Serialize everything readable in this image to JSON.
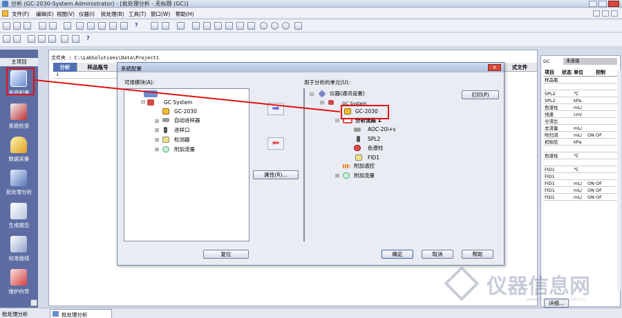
{
  "window": {
    "title": "分析 (GC-2030-System Administrator) - [批处理分析 - 无标题 (GC)]"
  },
  "menu": [
    "文件(F)",
    "编辑(E)",
    "视图(V)",
    "仪器(I)",
    "批处理(B)",
    "工具(T)",
    "窗口(W)",
    "帮助(H)"
  ],
  "left_panel": {
    "header": "主项目",
    "items": [
      "系统配置",
      "系统检查",
      "数据采集",
      "批处理分析",
      "生成报告",
      "校准曲线",
      "维护向导"
    ],
    "bottom_label": "批处理分析"
  },
  "main": {
    "file_path": "文件夹 : C:\\LabSolutions\\Data\\Project1",
    "columns": [
      "分析",
      "样品瓶号",
      "式文件"
    ],
    "row1": "1"
  },
  "right_panel": {
    "gc_label": "GC",
    "status": "未连接",
    "columns": [
      "项目",
      "状态",
      "单位",
      "控制"
    ],
    "rows": [
      {
        "name": "样品瓶",
        "unit": "",
        "ctrl": ""
      },
      {
        "name": "",
        "unit": "",
        "ctrl": ""
      },
      {
        "name": "SPL2",
        "unit": "℃",
        "ctrl": ""
      },
      {
        "name": "SPL2",
        "unit": "kPa",
        "ctrl": ""
      },
      {
        "name": "色谱柱",
        "unit": "mL/",
        "ctrl": ""
      },
      {
        "name": "线速",
        "unit": "cm/",
        "ctrl": ""
      },
      {
        "name": "分流比",
        "unit": "",
        "ctrl": ""
      },
      {
        "name": "总流量",
        "unit": "mL/",
        "ctrl": ""
      },
      {
        "name": "吹扫流",
        "unit": "mL/",
        "ctrl": "ON  OF"
      },
      {
        "name": "初始压",
        "unit": "kPa",
        "ctrl": ""
      },
      {
        "name": "",
        "unit": "",
        "ctrl": ""
      },
      {
        "name": "色谱柱",
        "unit": "℃",
        "ctrl": ""
      },
      {
        "name": "",
        "unit": "",
        "ctrl": ""
      },
      {
        "name": "FID1",
        "unit": "℃",
        "ctrl": ""
      },
      {
        "name": "FID1",
        "unit": "",
        "ctrl": ""
      },
      {
        "name": "FID1",
        "unit": "mL/",
        "ctrl": "ON  OF"
      },
      {
        "name": "FID1",
        "unit": "mL/",
        "ctrl": "ON  OF"
      },
      {
        "name": "FID1",
        "unit": "mL/",
        "ctrl": "ON  OF"
      }
    ],
    "detail_button": "详细..."
  },
  "dialog": {
    "title": "系统配置",
    "available_label": "可用模块(A):",
    "units_label": "用于分析的单元(U):",
    "left_tree": [
      "GC System",
      "GC-2030",
      "自动进样器",
      "进样口",
      "检测器",
      "附加流量"
    ],
    "right_tree": [
      "仪器(通讯设置)",
      "GC System",
      "GC-2030",
      "分析流路 1",
      "AOC-20i+s",
      "SPL2",
      "色谱柱",
      "FID1",
      "附加温控",
      "附加流量"
    ],
    "buttons": {
      "print": "打印(P)",
      "properties": "属性(R)...",
      "reset": "复位",
      "ok": "确定",
      "cancel": "取消",
      "help": "帮助"
    }
  },
  "bottom_tab": "批处理分析",
  "watermark": {
    "text": "仪器信息网",
    "url": "www.instrument.com.cn"
  },
  "colors": {
    "highlight_red": "#e01010",
    "nav_bg": "#5d6da3"
  }
}
